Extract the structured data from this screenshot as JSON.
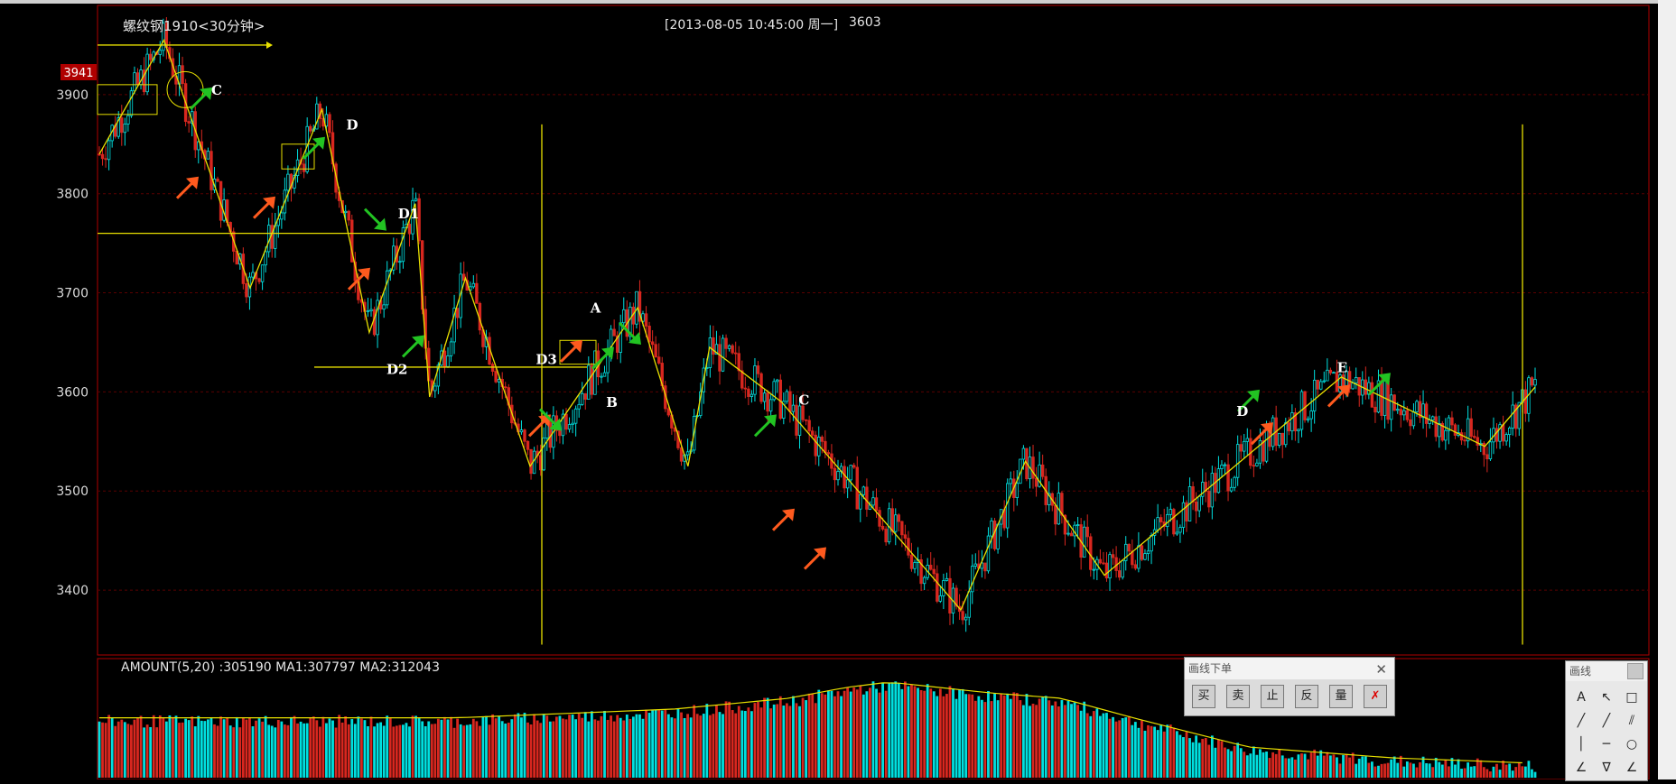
{
  "window": {
    "title": "螺纹钢1910<30分钟>",
    "info_time": "[2013-08-05  10:45:00 周一]",
    "info_value": "3603"
  },
  "price_axis": {
    "ticks": [
      3400,
      3500,
      3600,
      3700,
      3800,
      3900
    ],
    "high_badge": "3941",
    "ylim": [
      3340,
      3990
    ]
  },
  "indicator": {
    "label": "AMOUNT(5,20)  :305190 MA1:307797 MA2:312043"
  },
  "drawing_panel": {
    "title": "画线下单",
    "buttons": [
      "买",
      "卖",
      "止",
      "反",
      "量"
    ]
  },
  "tools_panel": {
    "title": "画线",
    "tools": [
      "A",
      "↖",
      "□",
      "╱",
      "╱",
      "⫽",
      "│",
      "─",
      "○",
      "∠",
      "∇",
      "∠"
    ]
  },
  "annotations": [
    {
      "text": "C",
      "x": 0.078,
      "price": 3900
    },
    {
      "text": "D",
      "x": 0.172,
      "price": 3865
    },
    {
      "text": "D1",
      "x": 0.208,
      "price": 3775
    },
    {
      "text": "D2",
      "x": 0.2,
      "price": 3618
    },
    {
      "text": "D3",
      "x": 0.304,
      "price": 3628
    },
    {
      "text": "A",
      "x": 0.342,
      "price": 3680
    },
    {
      "text": "B",
      "x": 0.353,
      "price": 3585
    },
    {
      "text": "C",
      "x": 0.487,
      "price": 3587
    },
    {
      "text": "D",
      "x": 0.792,
      "price": 3576
    },
    {
      "text": "E",
      "x": 0.862,
      "price": 3620
    }
  ],
  "chart_data": {
    "type": "candlestick",
    "zigzag": [
      {
        "x": 0.0,
        "price": 3840
      },
      {
        "x": 0.045,
        "price": 3955
      },
      {
        "x": 0.105,
        "price": 3705
      },
      {
        "x": 0.155,
        "price": 3885
      },
      {
        "x": 0.188,
        "price": 3660
      },
      {
        "x": 0.22,
        "price": 3790
      },
      {
        "x": 0.23,
        "price": 3595
      },
      {
        "x": 0.255,
        "price": 3715
      },
      {
        "x": 0.3,
        "price": 3525
      },
      {
        "x": 0.375,
        "price": 3685
      },
      {
        "x": 0.41,
        "price": 3525
      },
      {
        "x": 0.425,
        "price": 3645
      },
      {
        "x": 0.475,
        "price": 3590
      },
      {
        "x": 0.6,
        "price": 3380
      },
      {
        "x": 0.645,
        "price": 3530
      },
      {
        "x": 0.7,
        "price": 3415
      },
      {
        "x": 0.865,
        "price": 3615
      },
      {
        "x": 0.965,
        "price": 3545
      },
      {
        "x": 1.0,
        "price": 3605
      }
    ],
    "amount_profile": [
      {
        "x": 0.0,
        "v": 0.52
      },
      {
        "x": 0.1,
        "v": 0.52
      },
      {
        "x": 0.25,
        "v": 0.52
      },
      {
        "x": 0.4,
        "v": 0.6
      },
      {
        "x": 0.48,
        "v": 0.7
      },
      {
        "x": 0.52,
        "v": 0.8
      },
      {
        "x": 0.55,
        "v": 0.85
      },
      {
        "x": 0.62,
        "v": 0.75
      },
      {
        "x": 0.67,
        "v": 0.7
      },
      {
        "x": 0.72,
        "v": 0.52
      },
      {
        "x": 0.8,
        "v": 0.25
      },
      {
        "x": 0.9,
        "v": 0.15
      },
      {
        "x": 1.0,
        "v": 0.1
      }
    ],
    "ma_line": {
      "price": 3760
    },
    "ma_line2": {
      "price": 3625
    },
    "colors": {
      "up": "#00e0e0",
      "down": "#d8271f",
      "line": "#e8e000",
      "arrow_up": "#ff5a1e",
      "arrow_down": "#22c322",
      "grid": "#5a0000",
      "border": "#b00000"
    }
  }
}
